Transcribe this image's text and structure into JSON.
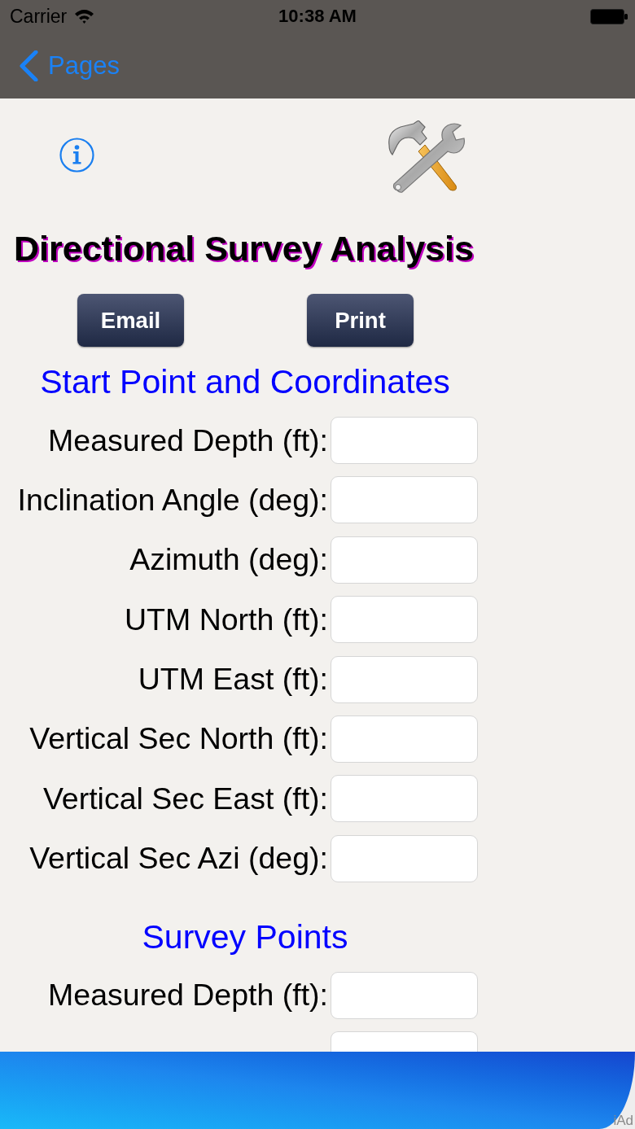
{
  "status_bar": {
    "carrier": "Carrier",
    "time": "10:38 AM"
  },
  "nav_bar": {
    "back_label": "Pages"
  },
  "title": "Directional Survey Analysis",
  "buttons": [
    "Email",
    "Print"
  ],
  "sections": [
    {
      "heading": "Start Point and Coordinates",
      "fields": [
        {
          "kind": "full",
          "label": "Measured Depth (ft):"
        },
        {
          "kind": "full",
          "label": "Inclination Angle (deg):"
        },
        {
          "kind": "full",
          "label": "Azimuth (deg):"
        },
        {
          "kind": "full",
          "label": "UTM North (ft):"
        },
        {
          "kind": "full",
          "label": "UTM East (ft):"
        },
        {
          "kind": "full",
          "label": "Vertical Sec North (ft):"
        },
        {
          "kind": "full",
          "label": "Vertical Sec East (ft):"
        },
        {
          "kind": "full",
          "label": "Vertical Sec Azi (deg):"
        }
      ]
    },
    {
      "heading": "Survey Points",
      "fields": [
        {
          "kind": "full",
          "label": "Measured Depth (ft):"
        },
        {
          "kind": "partial"
        }
      ]
    }
  ],
  "ad_banner": {
    "label": "iAd"
  }
}
